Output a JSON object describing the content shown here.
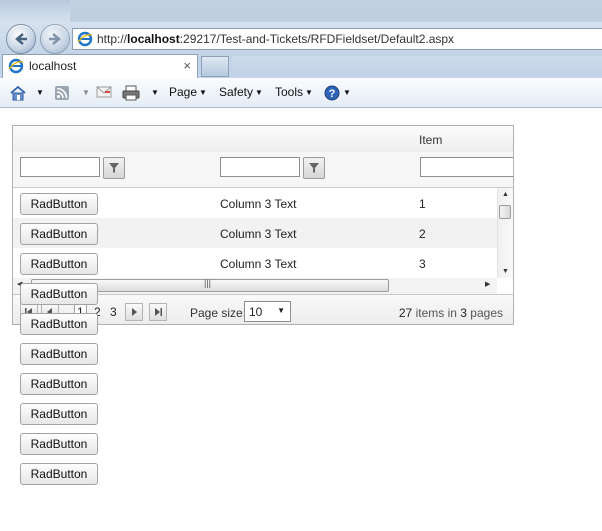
{
  "browser": {
    "url_prefix": "http://",
    "url_host": "localhost",
    "url_rest": ":29217/Test-and-Tickets/RFDFieldset/Default2.aspx",
    "tab_title": "localhost",
    "tab_close": "×",
    "command_bar": {
      "page": "Page",
      "safety": "Safety",
      "tools": "Tools"
    }
  },
  "grid": {
    "header": {
      "col3": "Item"
    },
    "rows": [
      {
        "button": "RadButton",
        "text": "Column 3 Text",
        "item": "1"
      },
      {
        "button": "RadButton",
        "text": "Column 3 Text",
        "item": "2"
      },
      {
        "button": "RadButton",
        "text": "Column 3 Text",
        "item": "3"
      }
    ],
    "pager": {
      "pages": [
        "1",
        "2",
        "3"
      ],
      "current_page": "1",
      "page_size_label": "Page size:",
      "page_size": "10",
      "items_count": "27",
      "items_in": "items in",
      "pages_count": "3",
      "pages_word": "pages"
    }
  },
  "overflow_buttons": [
    "RadButton",
    "RadButton",
    "RadButton",
    "RadButton",
    "RadButton",
    "RadButton",
    "RadButton"
  ],
  "colors": {
    "chrome": "#c3d4e8",
    "grid_border": "#b1b1b1",
    "alt_row": "#f2f2f2"
  }
}
